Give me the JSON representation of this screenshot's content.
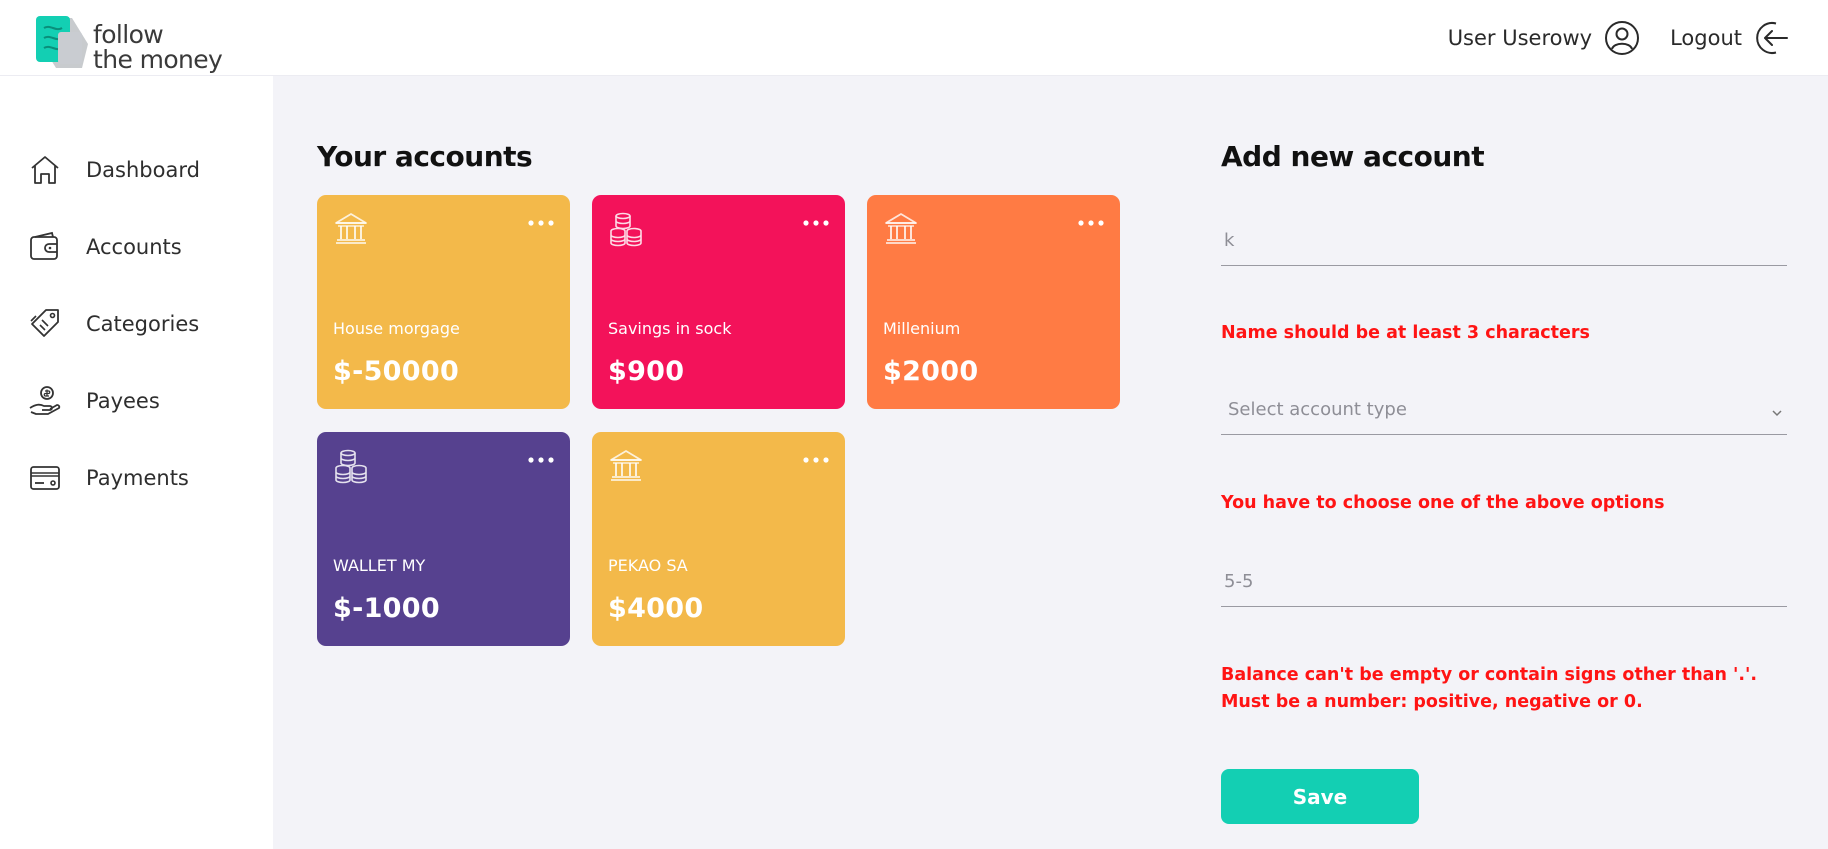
{
  "app": {
    "logo_line1": "follow",
    "logo_line2": "the money",
    "brand_color": "#13cfb3"
  },
  "header": {
    "user_name": "User Userowy",
    "user_icon": "user-circle-icon",
    "logout_label": "Logout",
    "logout_icon": "logout-arrow-icon"
  },
  "sidebar": {
    "items": [
      {
        "label": "Dashboard",
        "icon": "home-icon"
      },
      {
        "label": "Accounts",
        "icon": "wallet-icon"
      },
      {
        "label": "Categories",
        "icon": "tags-icon"
      },
      {
        "label": "Payees",
        "icon": "hand-coin-icon"
      },
      {
        "label": "Payments",
        "icon": "credit-card-icon"
      }
    ]
  },
  "accounts": {
    "title": "Your accounts",
    "cards": [
      {
        "name": "House morgage",
        "amount": "$-50000",
        "color": "#f3b94a",
        "icon": "bank-icon"
      },
      {
        "name": "Savings in sock",
        "amount": "$900",
        "color": "#f3125a",
        "icon": "coins-icon"
      },
      {
        "name": "Millenium",
        "amount": "$2000",
        "color": "#ff7b44",
        "icon": "bank-icon"
      },
      {
        "name": "WALLET MY",
        "amount": "$-1000",
        "color": "#56418f",
        "icon": "coins-icon"
      },
      {
        "name": "PEKAO SA",
        "amount": "$4000",
        "color": "#f3b94a",
        "icon": "bank-icon"
      }
    ]
  },
  "form": {
    "title": "Add new account",
    "name_value": "k",
    "name_error": "Name should be at least 3 characters",
    "type_placeholder": "Select account type",
    "type_error": "You have to choose one of the above options",
    "balance_value": "5-5",
    "balance_error": "Balance can't be empty or contain signs other than '.'. Must be a number: positive, negative or 0.",
    "save_label": "Save",
    "error_color": "#ff1414"
  }
}
